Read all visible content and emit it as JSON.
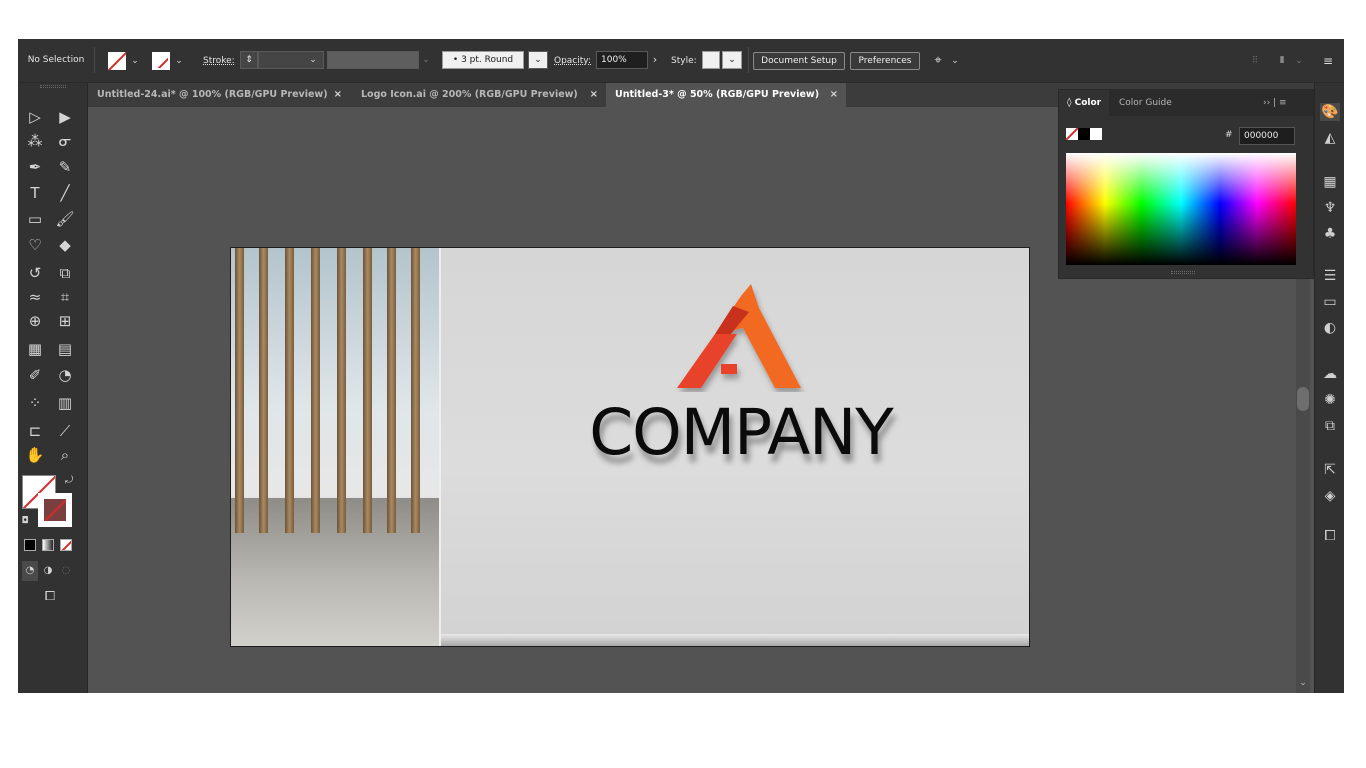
{
  "control_bar": {
    "selection_label": "No Selection",
    "stroke_label": "Stroke:",
    "brush_label": "3 pt. Round",
    "opacity_label": "Opacity:",
    "opacity_value": "100%",
    "style_label": "Style:",
    "document_setup": "Document Setup",
    "preferences": "Preferences"
  },
  "tabs": [
    {
      "label": "Untitled-24.ai* @ 100% (RGB/GPU Preview)",
      "close": "×",
      "active": false
    },
    {
      "label": "Logo Icon.ai @ 200% (RGB/GPU Preview)",
      "close": "×",
      "active": false
    },
    {
      "label": "Untitled-3* @ 50% (RGB/GPU Preview)",
      "close": "×",
      "active": true
    }
  ],
  "color_panel": {
    "tab_color": "Color",
    "tab_color_guide": "Color Guide",
    "hex_symbol": "#",
    "hex_value": "000000",
    "menu_glyph": "›› | ≡"
  },
  "artboard": {
    "wall_text": "COMPANY",
    "logo_colors": [
      "#e8432a",
      "#f26a21",
      "#c8321f"
    ]
  },
  "colors": {
    "app_bg": "#535353",
    "panel_bg": "#323232",
    "accent_stroke": "#d52b2b"
  }
}
